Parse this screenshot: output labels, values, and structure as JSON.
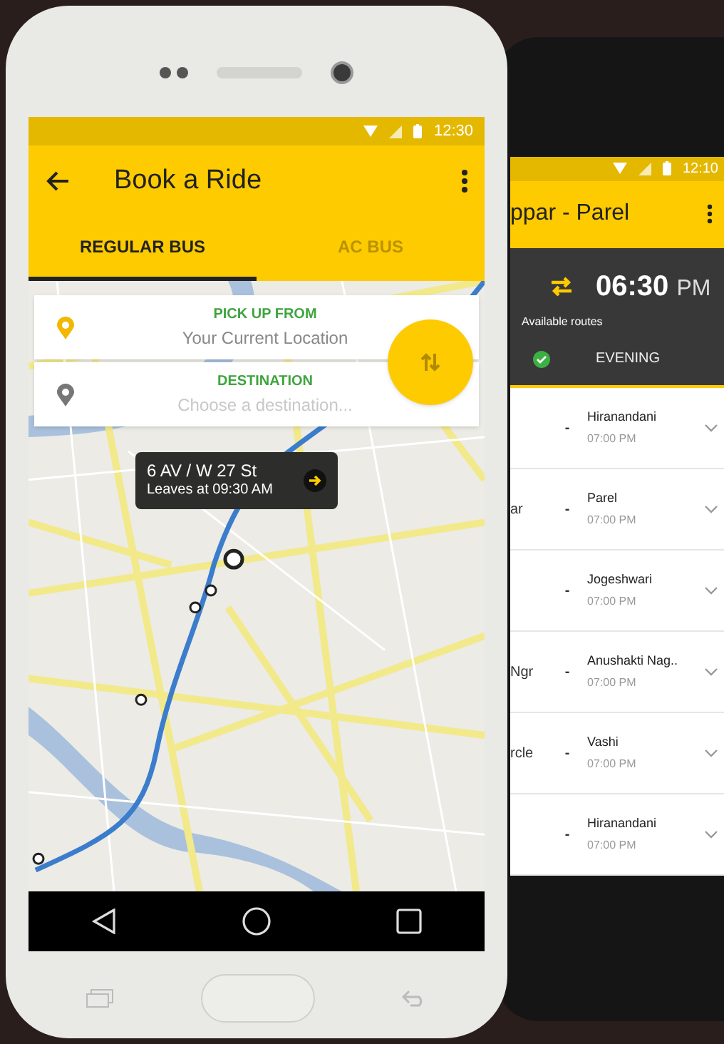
{
  "front_phone": {
    "status_bar": {
      "time": "12:30"
    },
    "app_bar": {
      "title": "Book a Ride"
    },
    "tabs": [
      {
        "label": "REGULAR BUS",
        "selected": true
      },
      {
        "label": "AC BUS",
        "selected": false
      }
    ],
    "pickup": {
      "label": "PICK UP FROM",
      "value": "Your Current Location"
    },
    "destination": {
      "label": "DESTINATION",
      "placeholder": "Choose a destination..."
    },
    "map_callout": {
      "stop": "6 AV / W 27 St",
      "departure": "Leaves at 09:30 AM"
    }
  },
  "back_phone": {
    "status_bar": {
      "time": "12:10"
    },
    "app_bar": {
      "title": "ppar - Parel"
    },
    "time": "06:30",
    "meridiem": "PM",
    "available_label": "Available routes",
    "period": {
      "label": "EVENING",
      "checked": true
    },
    "routes": [
      {
        "dash": "-",
        "to": "Hiranandani",
        "time": "07:00 PM"
      },
      {
        "from": "ar",
        "dash": "-",
        "to": "Parel",
        "time": "07:00 PM"
      },
      {
        "dash": "-",
        "to": "Jogeshwari",
        "time": "07:00 PM"
      },
      {
        "from": "Ngr",
        "dash": "-",
        "to": "Anushakti Nag..",
        "time": "07:00 PM"
      },
      {
        "from": "rcle",
        "dash": "-",
        "to": "Vashi",
        "time": "07:00 PM"
      },
      {
        "dash": "-",
        "to": "Hiranandani",
        "time": "07:00 PM"
      }
    ]
  }
}
